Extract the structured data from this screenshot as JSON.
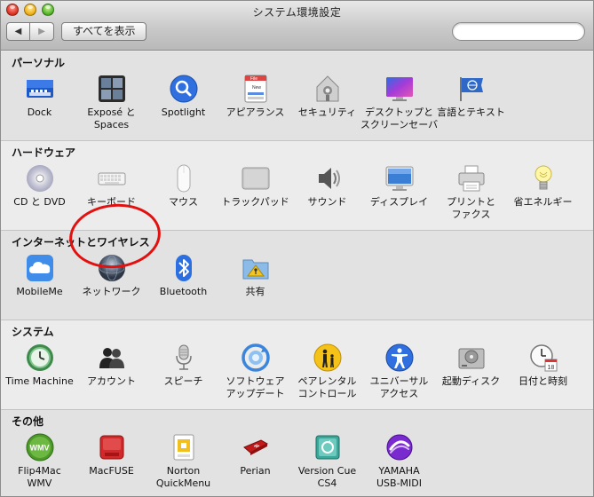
{
  "window": {
    "title": "システム環境設定"
  },
  "toolbar": {
    "back_glyph": "◀",
    "forward_glyph": "▶",
    "show_all_label": "すべてを表示",
    "search_placeholder": "",
    "search_value": ""
  },
  "sections": [
    {
      "title": "パーソナル",
      "items": [
        {
          "label": "Dock",
          "icon": "dock-icon"
        },
        {
          "label": "Exposé と\nSpaces",
          "icon": "expose-icon"
        },
        {
          "label": "Spotlight",
          "icon": "spotlight-icon"
        },
        {
          "label": "アピアランス",
          "icon": "appearance-icon"
        },
        {
          "label": "セキュリティ",
          "icon": "security-icon"
        },
        {
          "label": "デスクトップと\nスクリーンセーバ",
          "icon": "desktop-icon"
        },
        {
          "label": "言語とテキスト",
          "icon": "language-icon"
        }
      ]
    },
    {
      "title": "ハードウェア",
      "items": [
        {
          "label": "CD と DVD",
          "icon": "cd-icon"
        },
        {
          "label": "キーボード",
          "icon": "keyboard-icon"
        },
        {
          "label": "マウス",
          "icon": "mouse-icon"
        },
        {
          "label": "トラックパッド",
          "icon": "trackpad-icon"
        },
        {
          "label": "サウンド",
          "icon": "sound-icon"
        },
        {
          "label": "ディスプレイ",
          "icon": "display-icon"
        },
        {
          "label": "プリントと\nファクス",
          "icon": "printer-icon"
        },
        {
          "label": "省エネルギー",
          "icon": "energy-icon"
        }
      ]
    },
    {
      "title": "インターネットとワイヤレス",
      "items": [
        {
          "label": "MobileMe",
          "icon": "mobileme-icon"
        },
        {
          "label": "ネットワーク",
          "icon": "network-icon"
        },
        {
          "label": "Bluetooth",
          "icon": "bluetooth-icon"
        },
        {
          "label": "共有",
          "icon": "sharing-icon"
        }
      ]
    },
    {
      "title": "システム",
      "items": [
        {
          "label": "Time Machine",
          "icon": "timemachine-icon"
        },
        {
          "label": "アカウント",
          "icon": "accounts-icon"
        },
        {
          "label": "スピーチ",
          "icon": "speech-icon"
        },
        {
          "label": "ソフトウェア\nアップデート",
          "icon": "update-icon"
        },
        {
          "label": "ペアレンタル\nコントロール",
          "icon": "parental-icon"
        },
        {
          "label": "ユニバーサル\nアクセス",
          "icon": "access-icon"
        },
        {
          "label": "起動ディスク",
          "icon": "startup-icon"
        },
        {
          "label": "日付と時刻",
          "icon": "datetime-icon"
        }
      ]
    },
    {
      "title": "その他",
      "items": [
        {
          "label": "Flip4Mac\nWMV",
          "icon": "flip4mac-icon"
        },
        {
          "label": "MacFUSE",
          "icon": "macfuse-icon"
        },
        {
          "label": "Norton\nQuickMenu",
          "icon": "norton-icon"
        },
        {
          "label": "Perian",
          "icon": "perian-icon"
        },
        {
          "label": "Version Cue\nCS4",
          "icon": "versioncue-icon"
        },
        {
          "label": "YAMAHA\nUSB-MIDI",
          "icon": "yamaha-icon"
        }
      ]
    }
  ],
  "icon_texts": {
    "wmv": "WMV",
    "date_day": "18",
    "file_text": "File",
    "new_text": "New"
  },
  "annotation": {
    "color": "#e31010",
    "target": "ネットワーク"
  }
}
